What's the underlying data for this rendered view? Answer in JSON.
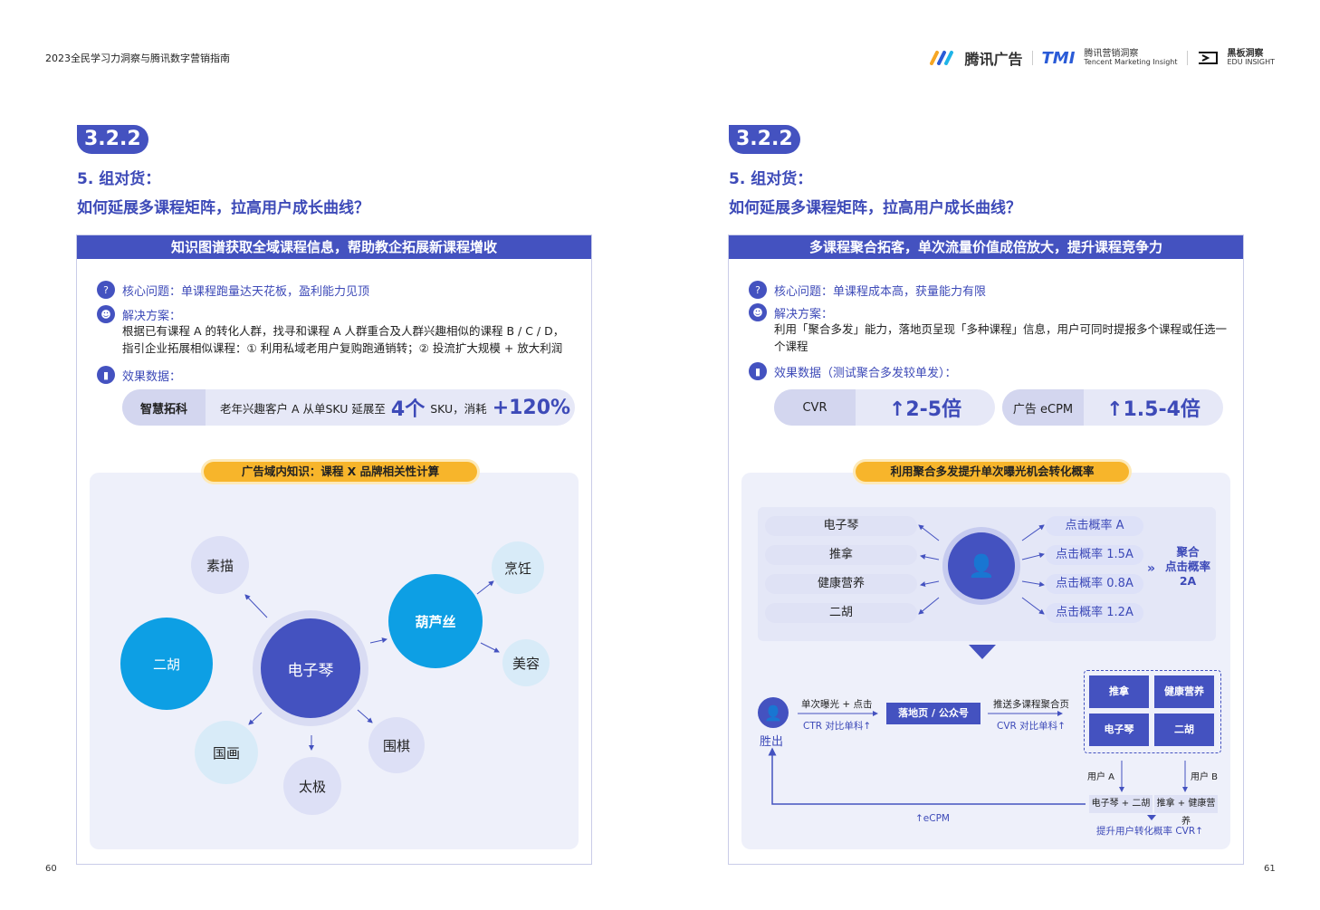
{
  "header": {
    "doc_title": "2023全民学习力洞察与腾讯数字营销指南",
    "logo_tencent_ads": "腾讯广告",
    "logo_tmi": "TMI",
    "logo_tmi_cn": "腾讯营销洞察",
    "logo_tmi_en": "Tencent Marketing Insight",
    "logo_heiban_cn": "黑板洞察",
    "logo_heiban_en": "EDU INSIGHT"
  },
  "left": {
    "page_number": "60",
    "section": "3.2.2",
    "heading1": "5. 组对货：",
    "heading2": "如何延展多课程矩阵，拉高用户成长曲线？",
    "banner": "知识图谱获取全域课程信息，帮助教企拓展新课程增收",
    "q_label": "核心问题：单课程跑量达天花板，盈利能力见顶",
    "solution_label": "解决方案：",
    "solution_text": "根据已有课程 A 的转化人群，找寻和课程 A 人群重合及人群兴趣相似的课程 B / C / D，指引企业拓展相似课程：① 利用私域老用户复购跑通销转；② 投流扩大规模 + 放大利润",
    "effect_label": "效果数据：",
    "pill_label": "智慧拓科",
    "pill_text1": "老年兴趣客户 A 从单SKU 延展至",
    "pill_big1": "4个",
    "pill_text2": "SKU，消耗",
    "pill_big2": "+120%",
    "diagram_tag": "广告域内知识：课程 X 品牌相关性计算",
    "nodes": {
      "center": "电子琴",
      "sumiao": "素描",
      "erhu": "二胡",
      "guohua": "国画",
      "taiji": "太极",
      "weiqi": "围棋",
      "hulusi": "葫芦丝",
      "pengren": "烹饪",
      "meirong": "美容"
    }
  },
  "right": {
    "page_number": "61",
    "section": "3.2.2",
    "heading1": "5. 组对货：",
    "heading2": "如何延展多课程矩阵，拉高用户成长曲线？",
    "banner": "多课程聚合拓客，单次流量价值成倍放大，提升课程竞争力",
    "q_label": "核心问题：单课程成本高，获量能力有限",
    "solution_label": "解决方案：",
    "solution_text": "利用「聚合多发」能力，落地页呈现「多种课程」信息，用户可同时提报多个课程或任选一个课程",
    "effect_label": "效果数据（测试聚合多发较单发）：",
    "pill1_label": "CVR",
    "pill1_value": "↑2-5倍",
    "pill2_label": "广告 eCPM",
    "pill2_value": "↑1.5-4倍",
    "diagram_tag": "利用聚合多发提升单次曝光机会转化概率",
    "courses": [
      "电子琴",
      "推拿",
      "健康营养",
      "二胡"
    ],
    "probs": [
      "点击概率 A",
      "点击概率 1.5A",
      "点击概率 0.8A",
      "点击概率 1.2A"
    ],
    "aggregate": "聚合\n点击概率\n2A",
    "flow": {
      "winner": "胜出",
      "step1_top": "单次曝光 + 点击",
      "step1_bottom": "CTR 对比单科↑",
      "landing": "落地页 / 公众号",
      "step2_top": "推送多课程聚合页",
      "step2_bottom": "CVR 对比单科↑",
      "grid": [
        "推拿",
        "健康营养",
        "电子琴",
        "二胡"
      ],
      "user_a": "用户 A",
      "user_b": "用户 B",
      "combo_a": "电子琴 + 二胡",
      "combo_b": "推拿 + 健康营养",
      "ecpm": "↑eCPM",
      "result": "提升用户转化概率 CVR↑"
    }
  }
}
